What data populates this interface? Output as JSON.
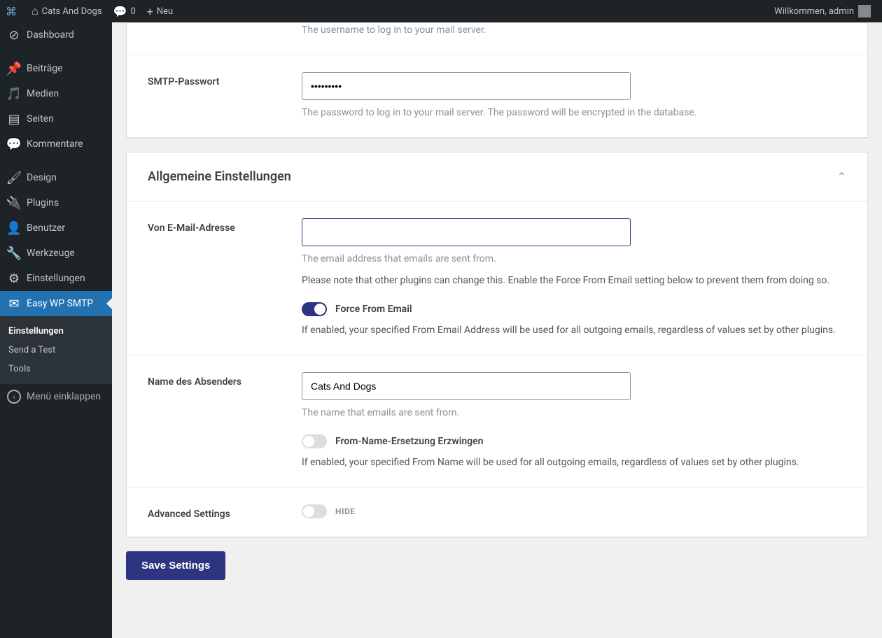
{
  "adminbar": {
    "site_name": "Cats And Dogs",
    "comments_count": "0",
    "new_label": "Neu",
    "greeting": "Willkommen, admin"
  },
  "sidebar": {
    "dashboard": "Dashboard",
    "posts": "Beiträge",
    "media": "Medien",
    "pages": "Seiten",
    "comments": "Kommentare",
    "design": "Design",
    "plugins": "Plugins",
    "users": "Benutzer",
    "tools": "Werkzeuge",
    "settings": "Einstellungen",
    "easy_wp_smtp": "Easy WP SMTP",
    "sub_settings": "Einstellungen",
    "sub_send_test": "Send a Test",
    "sub_tools": "Tools",
    "collapse": "Menü einklappen"
  },
  "smtp": {
    "username_help": "The username to log in to your mail server.",
    "password_label": "SMTP-Passwort",
    "password_value": "•••••••••",
    "password_help": "The password to log in to your mail server. The password will be encrypted in the database."
  },
  "general": {
    "title": "Allgemeine Einstellungen",
    "from_email_label": "Von E-Mail-Adresse",
    "from_email_value": "",
    "from_email_help": "The email address that emails are sent from.",
    "from_email_note": "Please note that other plugins can change this. Enable the Force From Email setting below to prevent them from doing so.",
    "force_from_email_label": "Force From Email",
    "force_from_email_on": true,
    "force_from_email_help": "If enabled, your specified From Email Address will be used for all outgoing emails, regardless of values set by other plugins.",
    "from_name_label": "Name des Absenders",
    "from_name_value": "Cats And Dogs",
    "from_name_help": "The name that emails are sent from.",
    "force_from_name_label": "From-Name-Ersetzung Erzwingen",
    "force_from_name_on": false,
    "force_from_name_help": "If enabled, your specified From Name will be used for all outgoing emails, regardless of values set by other plugins.",
    "advanced_label": "Advanced Settings",
    "advanced_hide": "HIDE",
    "advanced_on": false
  },
  "save_button": "Save Settings"
}
